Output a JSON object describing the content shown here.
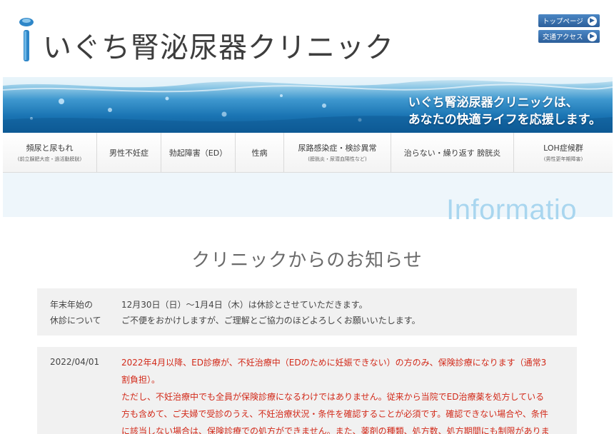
{
  "header": {
    "logo_text": "いぐち腎泌尿器クリニック",
    "logo_icon": "water-drop-logo-icon",
    "top_links": [
      {
        "label": "トップページ",
        "icon": "arrow-right-icon"
      },
      {
        "label": "交通アクセス",
        "icon": "arrow-right-icon"
      }
    ]
  },
  "banner": {
    "tagline_line1": "いぐち腎泌尿器クリニックは、",
    "tagline_line2": "あなたの快適ライフを応援します。"
  },
  "nav": [
    {
      "label": "頻尿と尿もれ",
      "sub": "(前立腺肥大症・過活動膀胱)"
    },
    {
      "label": "男性不妊症",
      "sub": ""
    },
    {
      "label": "勃起障害（ED）",
      "sub": ""
    },
    {
      "label": "性病",
      "sub": ""
    },
    {
      "label": "尿路感染症・検診異常",
      "sub": "(膀胱炎・尿潜血陽性など)"
    },
    {
      "label": "治らない・繰り返す 膀胱炎",
      "sub": ""
    },
    {
      "label": "LOH症候群",
      "sub": "(男性更年期障害)"
    }
  ],
  "info_word": "Informatio",
  "section_heading": "クリニックからのお知らせ",
  "notices": [
    {
      "head_line1": "年末年始の",
      "head_line2": "休診について",
      "body_line1": "12月30日（日）～1月4日（木）は休診とさせていただきます。",
      "body_line2": "ご不便をおかけしますが、ご理解とご協力のほどよろしくお願いいたします。"
    },
    {
      "date": "2022/04/01",
      "body_line1": "2022年4月以降、ED診療が、不妊治療中（EDのために妊娠できない）の方のみ、保険診療になります（通常3",
      "body_line2": "割負担）。",
      "body_line3": "ただし、不妊治療中でも全員が保険診療になるわけではありません。従来から当院でED治療薬を処方している",
      "body_line4": "方も含めて、ご夫婦で受診のうえ、不妊治療状況・条件を確認することが必須です。確認できない場合や、条件",
      "body_line5": "に該当しない場合は、保険診療での処方ができません。また、薬剤の種類、処方数、処方期間にも制限がありま"
    }
  ],
  "colors": {
    "notice_red": "#d22a1a",
    "link_blue": "#2c5f9a",
    "info_word": "#a9d6ef"
  }
}
